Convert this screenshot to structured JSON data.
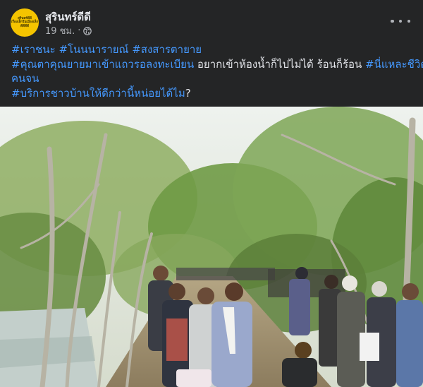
{
  "post": {
    "page_name": "สุรินทร์ดีดี",
    "time": "19 ชม.",
    "separator": "·",
    "avatar_text": [
      "สุรินทร์ดีดี",
      "เรื่องเล็กในเมืองเล็ก",
      "ดีดีดีดี"
    ],
    "privacy_icon": "globe-icon",
    "menu_icon": "more-options-icon"
  },
  "text": {
    "line1_tags": [
      "#เราชนะ",
      "#โนนนารายณ์",
      "#สงสารตายาย"
    ],
    "line2_tag1": "#คุณตาคุณยายมาเข้าแถวรอลงทะเบียน",
    "line2_plain": " อยากเข้าห้องน้ำก็ไปไม่ได้ ร้อนก็ร้อน ",
    "line2_tag2": "#นี่แหละชีวิต",
    "line3_tag": "คนจน",
    "line4_tag": "#บริการชาวบ้านให้ดีกว่านี้หน่อยได้ไม",
    "line4_plain": "?"
  },
  "photo": {
    "alt_icon": "photo-image",
    "colors": {
      "sky": "#e7ece6",
      "foliage": "#7a9a4e",
      "foliage_dark": "#4f6b34",
      "ground": "#a89a7d",
      "water": "#c7d2cf"
    }
  }
}
